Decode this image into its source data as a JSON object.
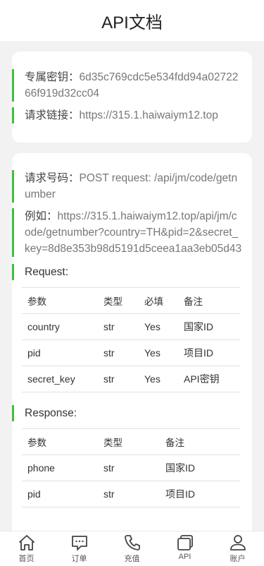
{
  "header": {
    "title": "API文档"
  },
  "card1": {
    "key_label": "专属密钥：",
    "key_value": "6d35c769cdc5e534fdd94a0272266f919d32cc04",
    "url_label": "请求链接：",
    "url_value": "https://315.1.haiwaiym12.top"
  },
  "card2": {
    "req_label": "请求号码：",
    "req_value": "POST request: /api/jm/code/getnumber",
    "example_label": "例如：",
    "example_value": "https://315.1.haiwaiym12.top/api/jm/code/getnumber?country=TH&pid=2&secret_key=8d8e353b98d5191d5ceea1aa3eb05d43",
    "request_title": "Request:",
    "request_table": {
      "headers": [
        "参数",
        "类型",
        "必填",
        "备注"
      ],
      "rows": [
        [
          "country",
          "str",
          "Yes",
          "国家ID"
        ],
        [
          "pid",
          "str",
          "Yes",
          "项目ID"
        ],
        [
          "secret_key",
          "str",
          "Yes",
          "API密钥"
        ]
      ]
    },
    "response_title": "Response:",
    "response_table": {
      "headers": [
        "参数",
        "类型",
        "备注"
      ],
      "rows": [
        [
          "phone",
          "str",
          "国家ID"
        ],
        [
          "pid",
          "str",
          "项目ID"
        ]
      ]
    }
  },
  "tabbar": {
    "items": [
      {
        "label": "首页",
        "icon": "home-icon"
      },
      {
        "label": "订单",
        "icon": "chat-icon"
      },
      {
        "label": "充值",
        "icon": "phone-icon"
      },
      {
        "label": "API",
        "icon": "cards-icon"
      },
      {
        "label": "账户",
        "icon": "user-icon"
      }
    ]
  }
}
